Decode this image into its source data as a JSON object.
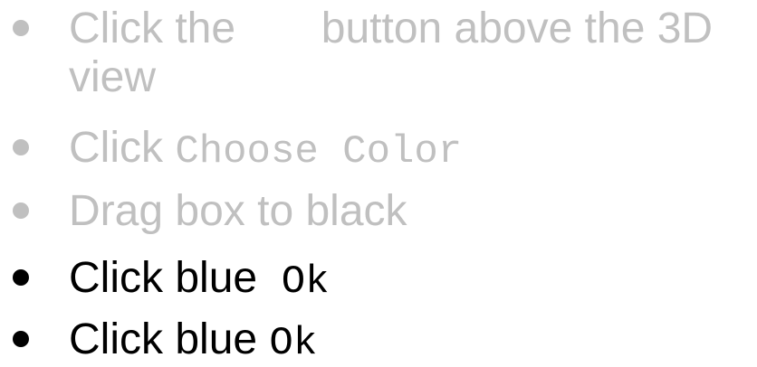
{
  "items": [
    {
      "part1": "Click the",
      "part2": "button above the 3D",
      "part3": "view",
      "color": "#c0c0c0"
    },
    {
      "part1": "Click",
      "code": "Choose Color",
      "color": "#c0c0c0"
    },
    {
      "text": "Drag box to black",
      "color": "#c0c0c0"
    },
    {
      "part1": "Click blue",
      "code": "Ok",
      "color": "#000000"
    },
    {
      "part1": "Click blue",
      "code": "Ok",
      "color": "#000000"
    }
  ]
}
